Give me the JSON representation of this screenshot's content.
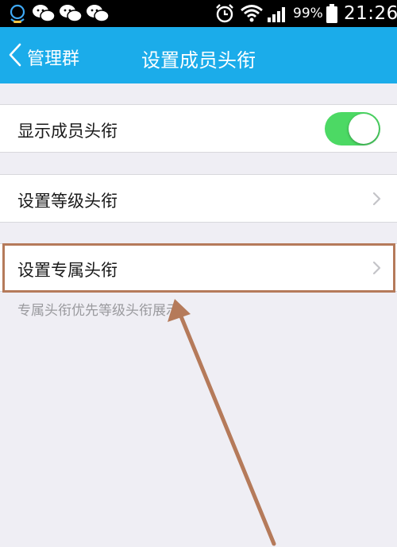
{
  "status_bar": {
    "battery_percent": "99%",
    "time": "21:26",
    "icons": [
      "qq-icon",
      "wechat-icon",
      "wechat-icon",
      "wechat-icon",
      "alarm-clock-icon",
      "wifi-icon",
      "signal-icon",
      "battery-icon"
    ]
  },
  "nav": {
    "back_label": "管理群",
    "title": "设置成员头衔"
  },
  "settings": {
    "show_member_title": {
      "label": "显示成员头衔",
      "enabled": true
    },
    "level_title": {
      "label": "设置等级头衔"
    },
    "exclusive_title": {
      "label": "设置专属头衔"
    },
    "footnote": "专属头衔优先等级头衔展示"
  },
  "colors": {
    "nav_bar": "#1bacea",
    "toggle_on": "#4cd964",
    "page_background": "#efeef4",
    "annotation": "#b57a5a"
  }
}
